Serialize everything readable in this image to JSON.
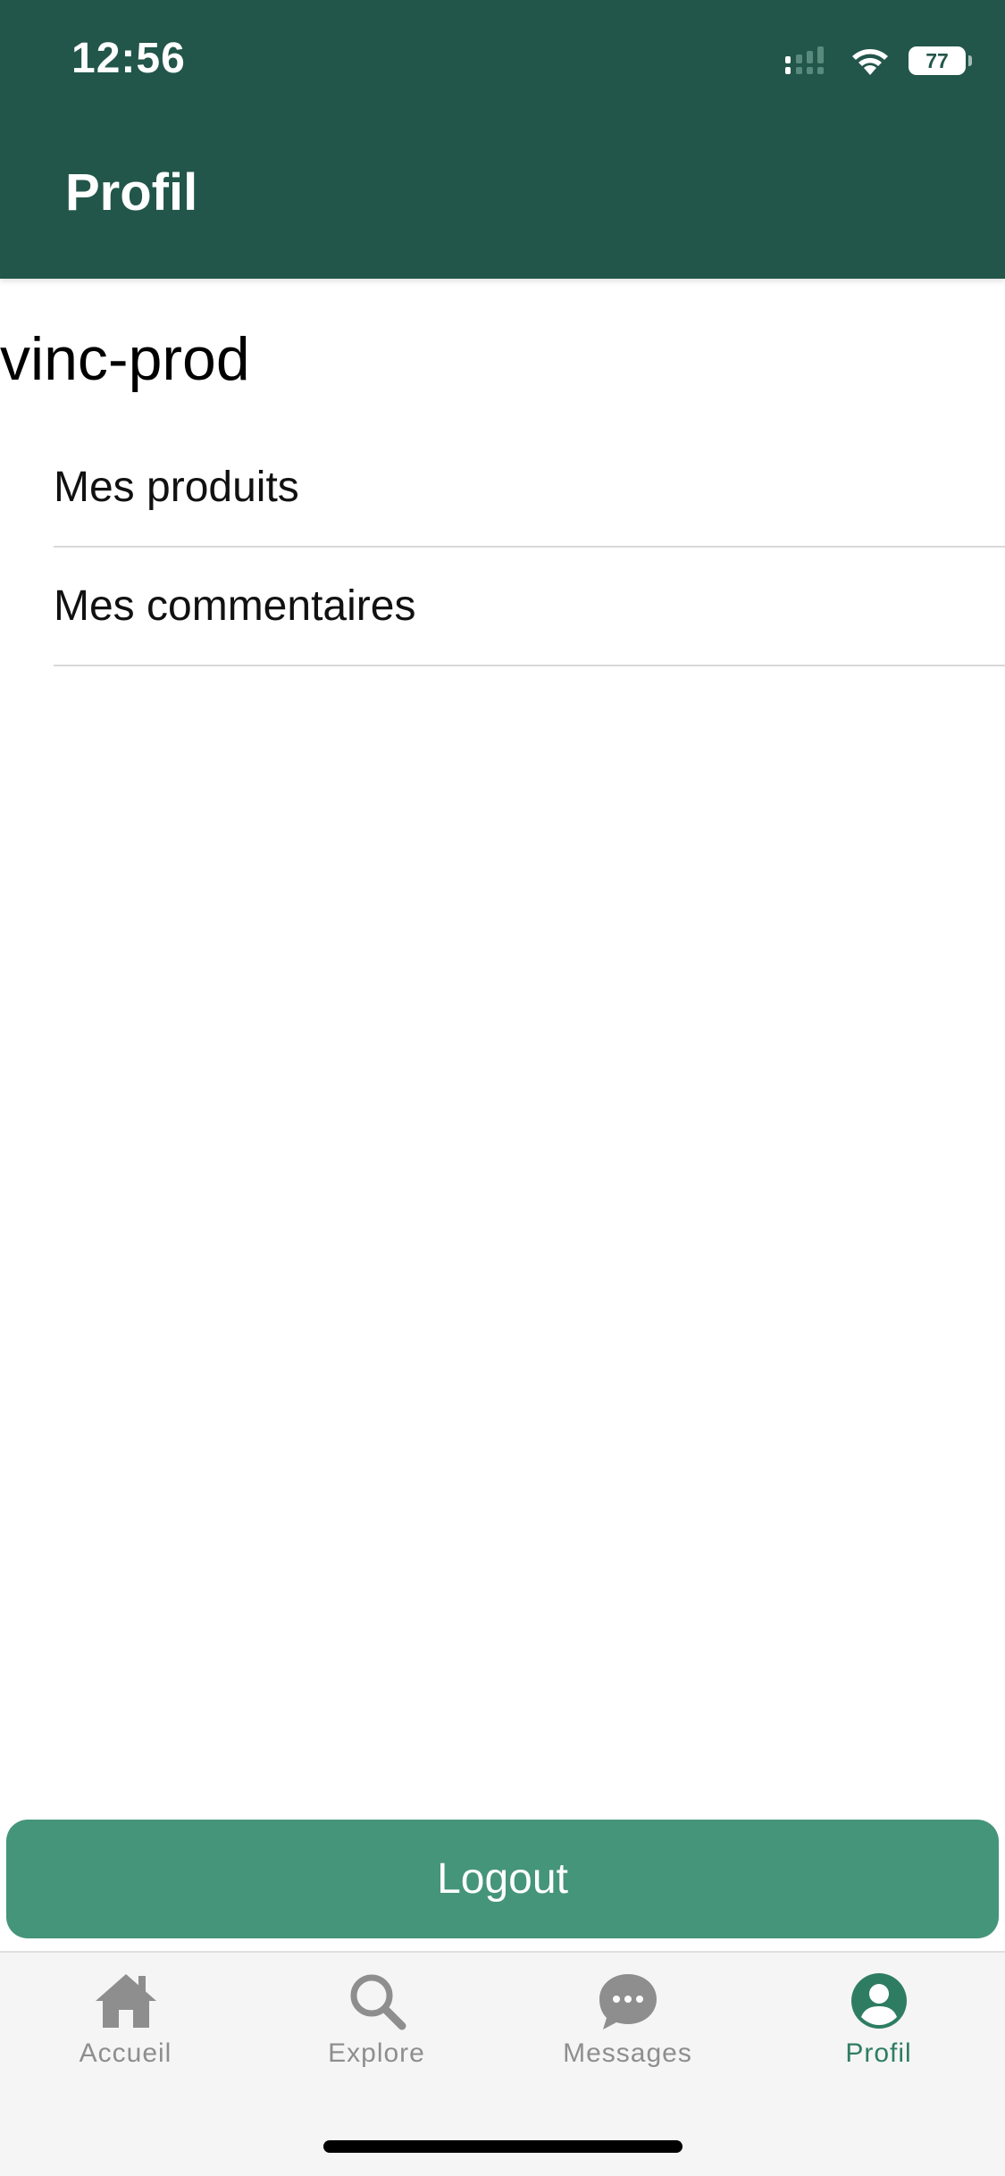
{
  "status_bar": {
    "time": "12:56",
    "battery_level": "77"
  },
  "header": {
    "title": "Profil"
  },
  "profile": {
    "username": "vinc-prod"
  },
  "menu": {
    "items": [
      {
        "label": "Mes produits"
      },
      {
        "label": "Mes commentaires"
      }
    ]
  },
  "logout": {
    "label": "Logout"
  },
  "tab_bar": {
    "tabs": [
      {
        "label": "Accueil",
        "icon": "home-icon",
        "active": false
      },
      {
        "label": "Explore",
        "icon": "search-icon",
        "active": false
      },
      {
        "label": "Messages",
        "icon": "chat-bubble-icon",
        "active": false
      },
      {
        "label": "Profil",
        "icon": "user-icon",
        "active": true
      }
    ]
  },
  "colors": {
    "header_bg": "#22564a",
    "button_bg": "#45957a",
    "active_tab": "#2e7d63",
    "inactive_tab": "#8e8e8e"
  }
}
